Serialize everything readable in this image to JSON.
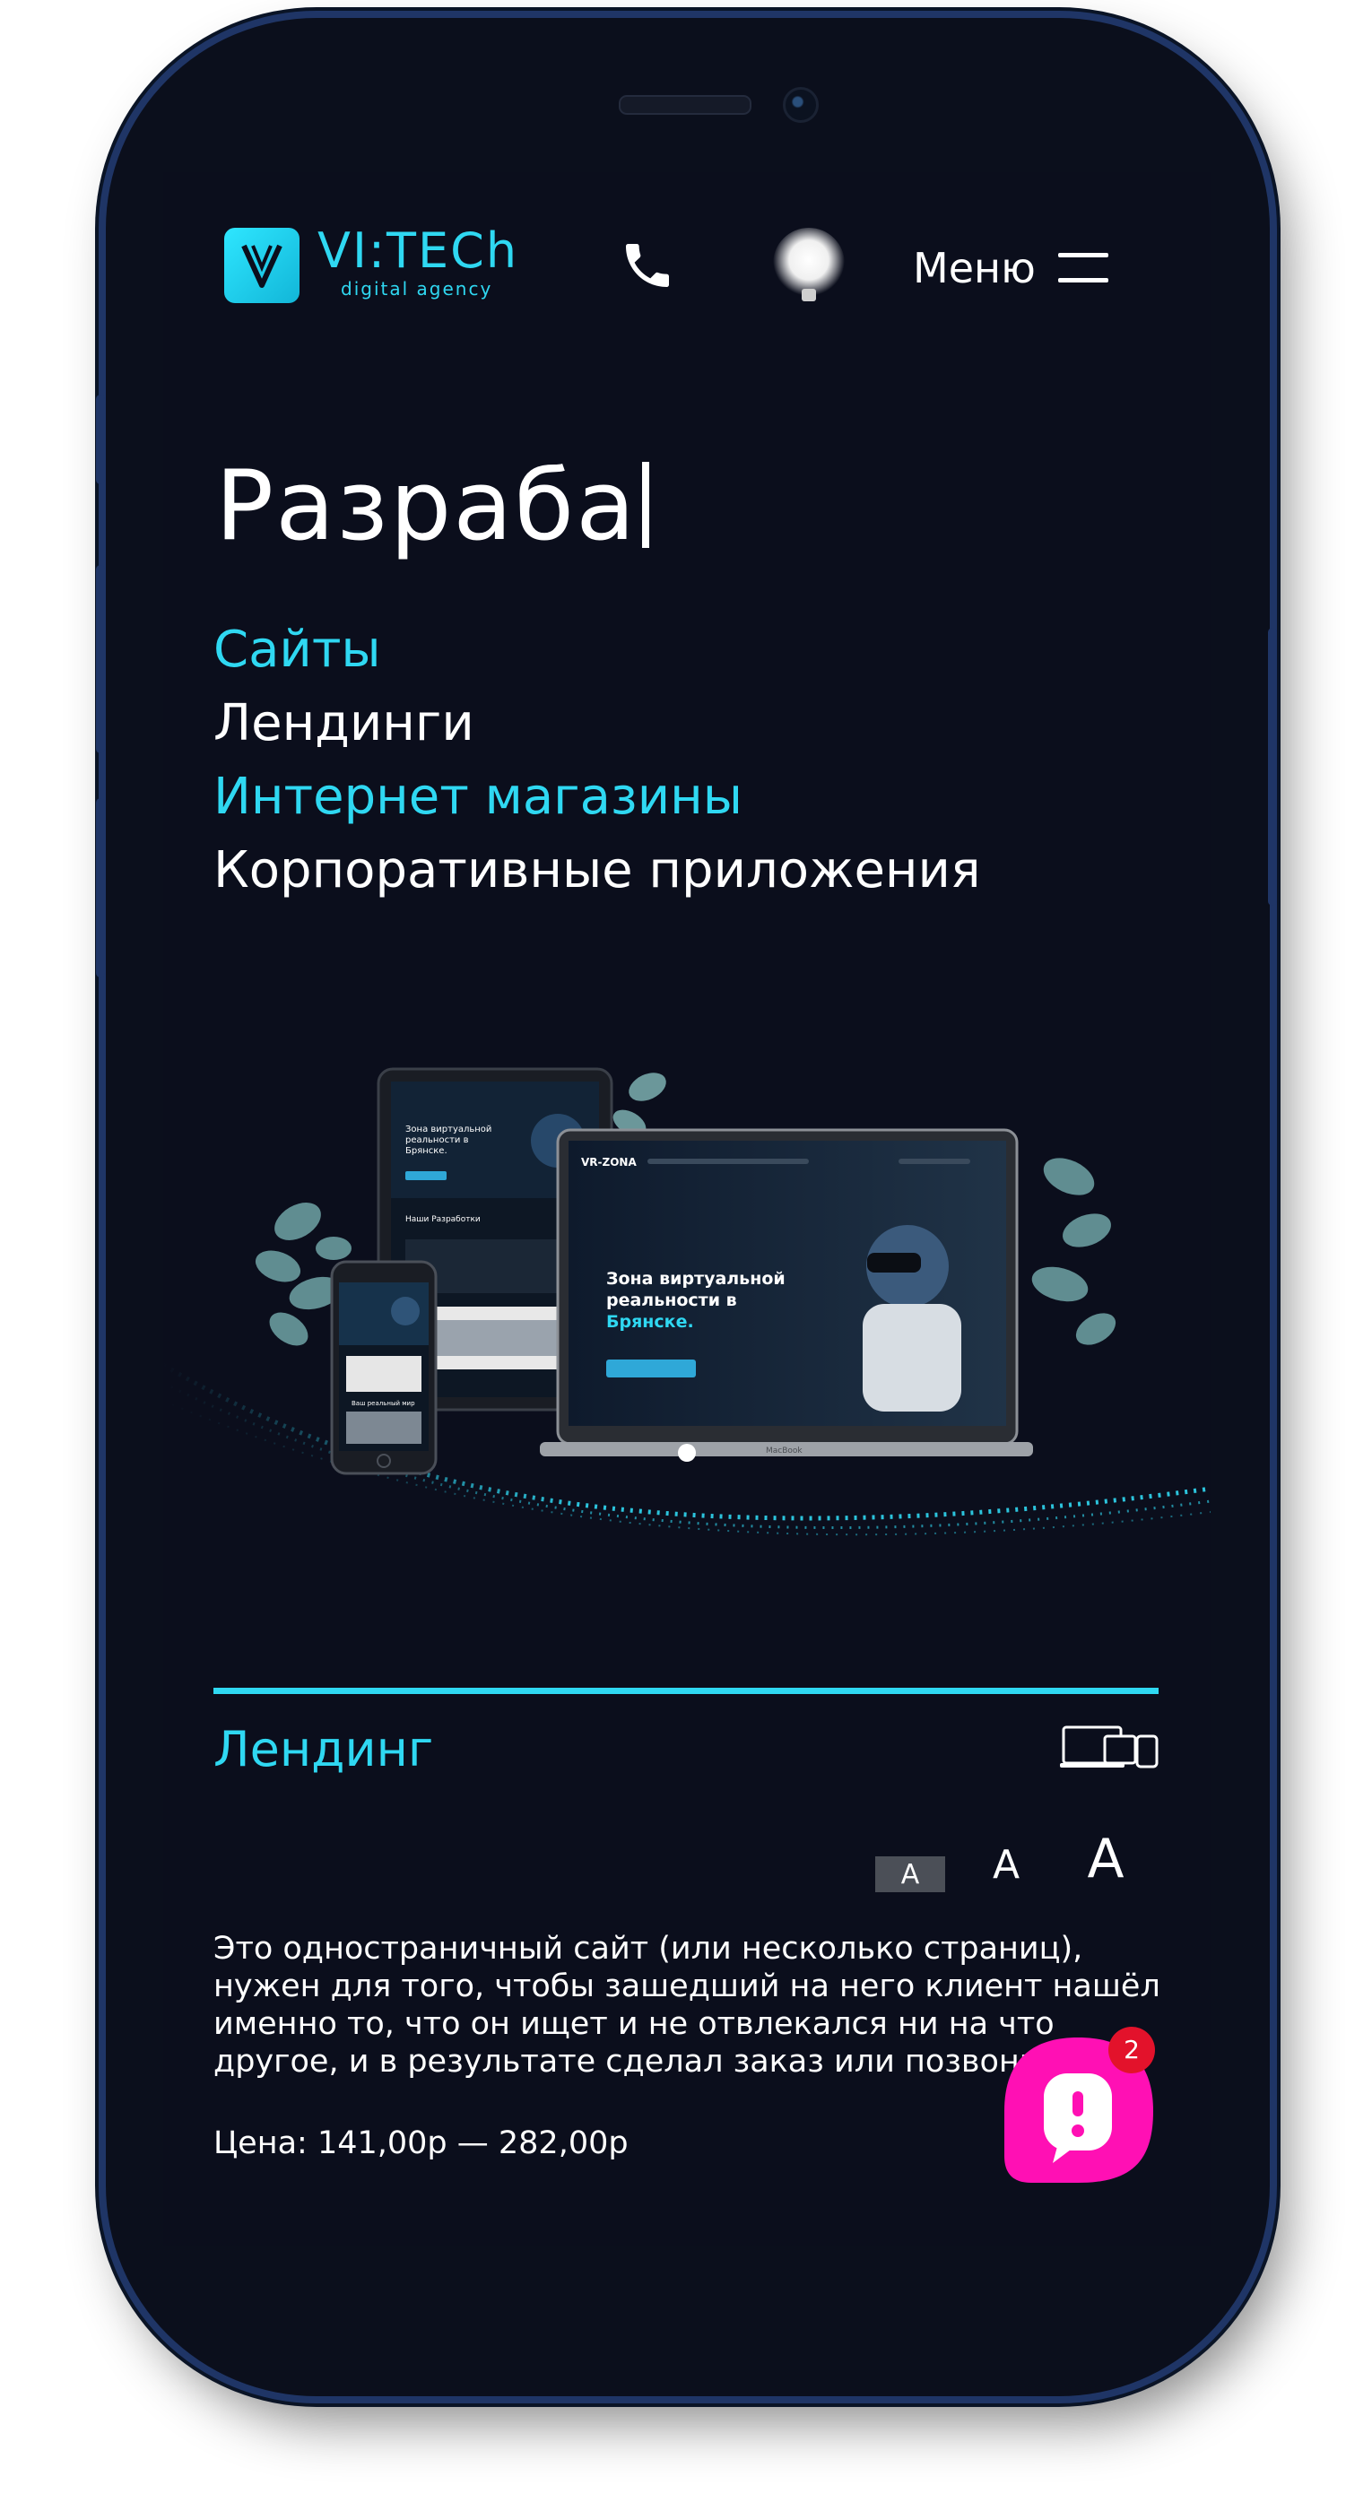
{
  "header": {
    "logo_text": "VI:TECh",
    "logo_sub": "digital agency",
    "menu_label": "Меню",
    "icons": [
      "logo-v-icon",
      "phone-icon",
      "lightbulb-icon",
      "hamburger-menu-icon"
    ]
  },
  "hero": {
    "typing_text": "Разраба",
    "services": [
      "Сайты",
      "Лендинги",
      "Интернет магазины",
      "Корпоративные приложения"
    ]
  },
  "showcase": {
    "vr_logo": "VR-ZONA",
    "vr_headline": [
      "Зона виртуальной",
      "реальности в",
      "Брянске."
    ],
    "tablet_headline": [
      "Зона виртуальной",
      "реальности в",
      "Брянске."
    ],
    "tablet_section": "Наши Разработки",
    "phone_section": "Ваш реальный мир",
    "laptop_brand": "MacBook"
  },
  "tab": {
    "title": "Лендинг",
    "font_sizes": [
      "A",
      "A",
      "A"
    ],
    "description": "Это одностраничный сайт (или несколько страниц), нужен для того, чтобы зашедший на него клиент нашёл именно то, что он ищет и не отвлекался ни на что другое, и в результате сделал заказ или позвонил.",
    "price": "Цена: 141,00р — 282,00р"
  },
  "chat": {
    "badge_count": "2"
  },
  "colors": {
    "accent": "#2fd8f2",
    "background": "#0b0e1c",
    "chat": "#ff10b4",
    "badge": "#e3122b"
  }
}
